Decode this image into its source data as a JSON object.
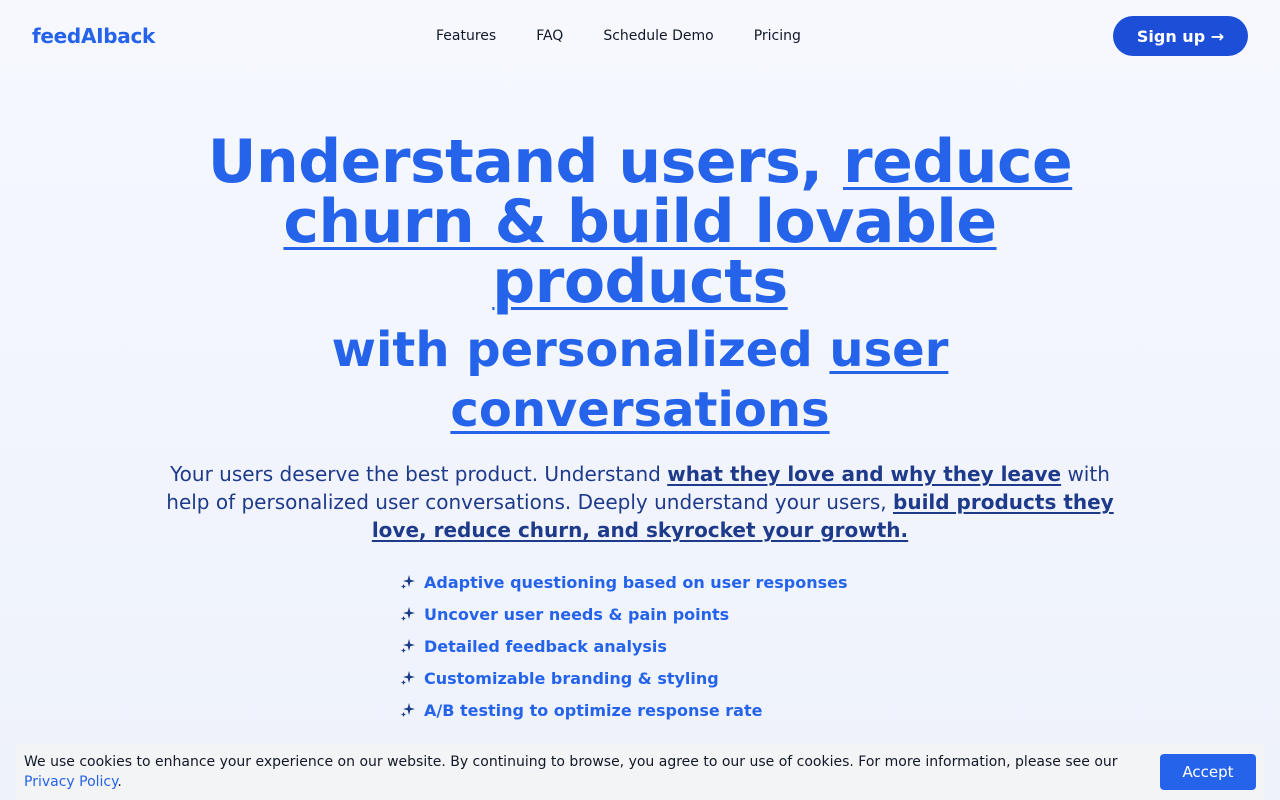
{
  "header": {
    "logo": "feedAIback",
    "nav": [
      "Features",
      "FAQ",
      "Schedule Demo",
      "Pricing"
    ],
    "signup_label": "Sign up →"
  },
  "hero": {
    "title_plain": "Understand users, ",
    "title_underlined": "reduce churn & build lovable products",
    "subtitle_plain": "with personalized ",
    "subtitle_underlined": "user conversations",
    "lede": {
      "part1": "Your users deserve the best product. Understand ",
      "emph1": "what they love and why they leave",
      "part2": " with help of personalized user conversations. Deeply understand your users, ",
      "emph2": "build products they love, reduce churn, and skyrocket your growth."
    },
    "features": [
      "Adaptive questioning based on user responses",
      "Uncover user needs & pain points",
      "Detailed feedback analysis",
      "Customizable branding & styling",
      "A/B testing to optimize response rate"
    ]
  },
  "cookie": {
    "text": "We use cookies to enhance your experience on our website. By continuing to browse, you agree to our use of cookies. For more information, please see our ",
    "link": "Privacy Policy",
    "end": ".",
    "accept_label": "Accept"
  },
  "colors": {
    "accent": "#2563eb",
    "button_dark": "#1d4ed8",
    "text_dark": "#1e3a8a"
  }
}
